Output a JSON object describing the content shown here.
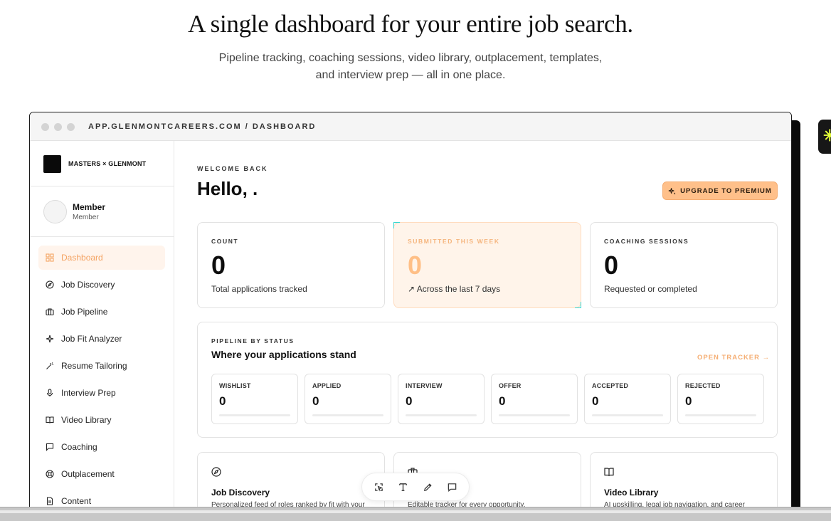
{
  "hero": {
    "title": "A single dashboard for your entire job search.",
    "subtitle_line1": "Pipeline tracking, coaching sessions, video library, outplacement, templates,",
    "subtitle_line2": "and interview prep — all in one place."
  },
  "window": {
    "url": "APP.GLENMONTCAREERS.COM / DASHBOARD"
  },
  "sidebar": {
    "brand": "MASTERS × GLENMONT",
    "member_name": "Member",
    "member_role": "Member",
    "items": [
      {
        "label": "Dashboard",
        "icon": "grid-icon",
        "active": true
      },
      {
        "label": "Job Discovery",
        "icon": "compass-icon"
      },
      {
        "label": "Job Pipeline",
        "icon": "briefcase-icon"
      },
      {
        "label": "Job Fit Analyzer",
        "icon": "sparkles-icon"
      },
      {
        "label": "Resume Tailoring",
        "icon": "wand-icon"
      },
      {
        "label": "Interview Prep",
        "icon": "microphone-icon"
      },
      {
        "label": "Video Library",
        "icon": "book-icon"
      },
      {
        "label": "Coaching",
        "icon": "message-icon"
      },
      {
        "label": "Outplacement",
        "icon": "lifebuoy-icon"
      },
      {
        "label": "Content",
        "icon": "document-icon"
      }
    ]
  },
  "main": {
    "welcome": "WELCOME BACK",
    "hello": "Hello, .",
    "upgrade_label": "UPGRADE TO PREMIUM",
    "accent_color": "#ffc08a",
    "cards": [
      {
        "label": "COUNT",
        "value": "0",
        "desc": "Total applications tracked"
      },
      {
        "label": "SUBMITTED THIS WEEK",
        "value": "0",
        "desc": "↗ Across the last 7 days"
      },
      {
        "label": "COACHING SESSIONS",
        "value": "0",
        "desc": "Requested or completed"
      }
    ],
    "pipeline": {
      "label": "PIPELINE BY STATUS",
      "title": "Where your applications stand",
      "link": "OPEN TRACKER →",
      "statuses": [
        {
          "name": "WISHLIST",
          "value": "0",
          "fraction": 0
        },
        {
          "name": "APPLIED",
          "value": "0",
          "fraction": 0
        },
        {
          "name": "INTERVIEW",
          "value": "0",
          "fraction": 0
        },
        {
          "name": "OFFER",
          "value": "0",
          "fraction": 0
        },
        {
          "name": "ACCEPTED",
          "value": "0",
          "fraction": 0
        },
        {
          "name": "REJECTED",
          "value": "0",
          "fraction": 0
        }
      ]
    },
    "features": [
      {
        "title": "Job Discovery",
        "desc": "Personalized feed of roles ranked by fit with your",
        "icon": "compass-icon"
      },
      {
        "title": "",
        "desc": "Editable tracker for every opportunity.",
        "icon": "briefcase-icon"
      },
      {
        "title": "Video Library",
        "desc": "AI upskilling, legal job navigation, and career",
        "icon": "book-icon"
      }
    ]
  },
  "toolbar": {
    "tools": [
      "select-icon",
      "text-icon",
      "pen-icon",
      "comment-icon"
    ]
  }
}
